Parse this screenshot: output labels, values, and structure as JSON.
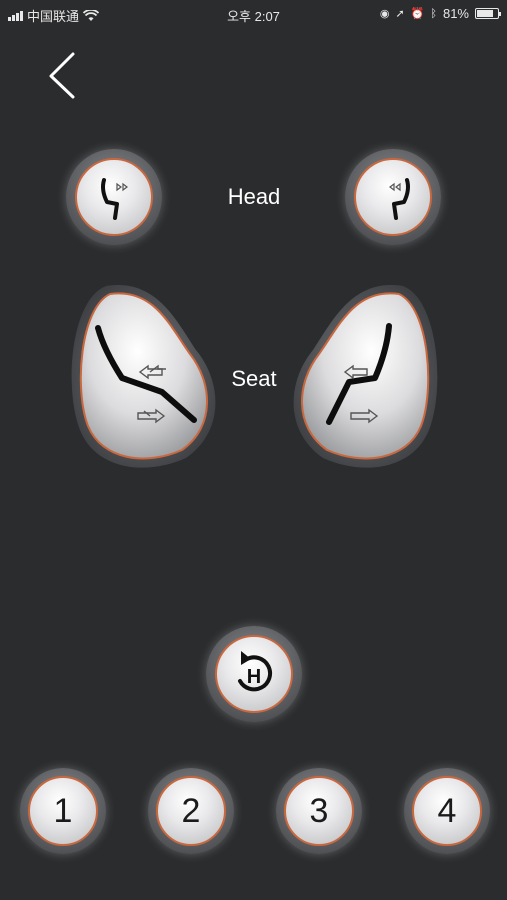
{
  "status_bar": {
    "carrier": "中国联通",
    "time": "오후 2:07",
    "battery": "81%",
    "battery_level": 0.81
  },
  "nav": {
    "back_icon": "chevron-left-icon"
  },
  "head": {
    "label": "Head"
  },
  "seat": {
    "label": "Seat"
  },
  "home_button": {
    "icon": "home-position-icon",
    "text": "H"
  },
  "presets": [
    "1",
    "2",
    "3",
    "4"
  ],
  "colors": {
    "background": "#2b2c2e",
    "accent_ring": "#c9683f"
  }
}
